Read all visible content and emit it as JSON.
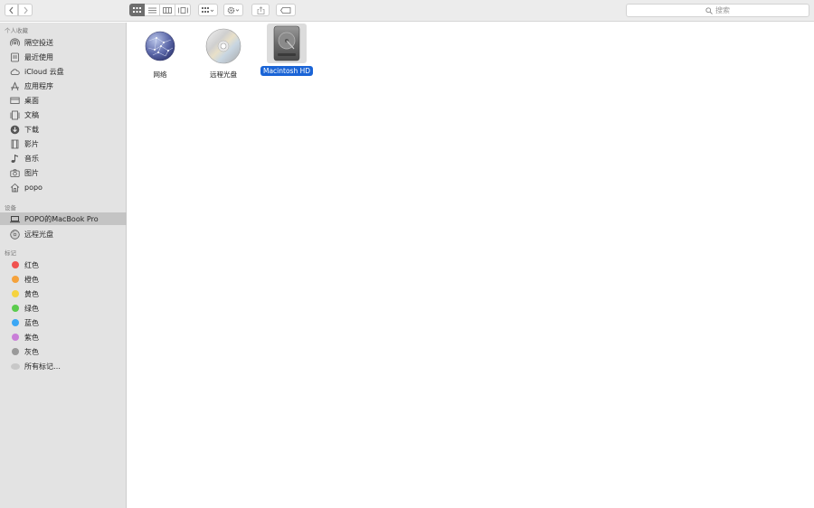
{
  "toolbar": {
    "nav": {
      "back_icon": "chevron-left-icon",
      "forward_icon": "chevron-right-icon"
    },
    "view_modes": [
      "icon-view",
      "list-view",
      "column-view",
      "gallery-view"
    ],
    "active_view": "icon-view",
    "search": {
      "placeholder": "搜索",
      "icon": "magnifier-icon"
    }
  },
  "sidebar": {
    "favorites": {
      "header": "个人收藏",
      "items": [
        {
          "label": "隔空投送",
          "icon": "airdrop-icon"
        },
        {
          "label": "最近使用",
          "icon": "recents-icon"
        },
        {
          "label": "iCloud 云盘",
          "icon": "cloud-icon"
        },
        {
          "label": "应用程序",
          "icon": "applications-icon"
        },
        {
          "label": "桌面",
          "icon": "desktop-icon"
        },
        {
          "label": "文稿",
          "icon": "documents-icon"
        },
        {
          "label": "下载",
          "icon": "download-icon"
        },
        {
          "label": "影片",
          "icon": "movies-icon"
        },
        {
          "label": "音乐",
          "icon": "music-icon"
        },
        {
          "label": "图片",
          "icon": "camera-icon"
        },
        {
          "label": "popo",
          "icon": "home-icon"
        }
      ]
    },
    "devices": {
      "header": "设备",
      "items": [
        {
          "label": "POPO的MacBook Pro",
          "icon": "laptop-icon",
          "selected": true
        },
        {
          "label": "远程光盘",
          "icon": "remote-disc-icon"
        }
      ]
    },
    "tags": {
      "header": "标记",
      "items": [
        {
          "label": "红色",
          "color": "#f0524f"
        },
        {
          "label": "橙色",
          "color": "#f5a23c"
        },
        {
          "label": "黄色",
          "color": "#f6d33f"
        },
        {
          "label": "绿色",
          "color": "#5bcb4d"
        },
        {
          "label": "蓝色",
          "color": "#3ba7f5"
        },
        {
          "label": "紫色",
          "color": "#c97ed8"
        },
        {
          "label": "灰色",
          "color": "#9a9a9a"
        },
        {
          "label": "所有标记…",
          "color": "#c8c8c8"
        }
      ]
    }
  },
  "main": {
    "files": [
      {
        "name": "网络",
        "icon": "network-globe-icon",
        "selected": false
      },
      {
        "name": "远程光盘",
        "icon": "cd-disc-icon",
        "selected": false
      },
      {
        "name": "Macintosh HD",
        "icon": "hard-drive-icon",
        "selected": true
      }
    ]
  }
}
